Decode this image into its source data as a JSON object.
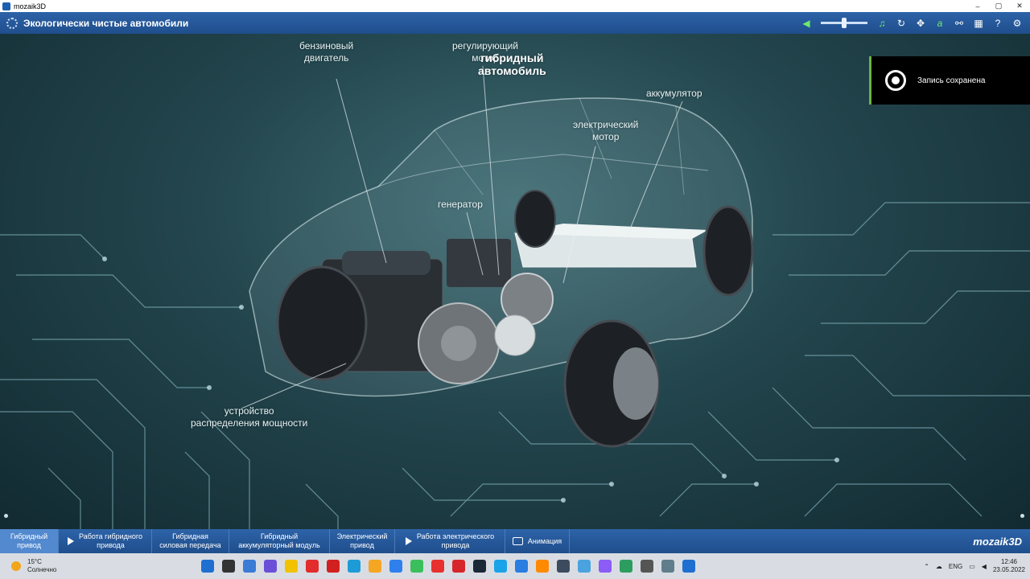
{
  "window": {
    "title": "mozaik3D",
    "controls": [
      "–",
      "▢",
      "✕"
    ]
  },
  "header": {
    "title": "Экологически чистые автомобили",
    "tools": [
      "music-icon",
      "reload-icon",
      "move-icon",
      "text-icon",
      "link-icon",
      "grid-icon",
      "help-icon",
      "settings-icon"
    ]
  },
  "scene": {
    "labels": {
      "engine": "бензиновый\nдвигатель",
      "regulating_motor": "регулирующий\nмотор",
      "hybrid_car": "гибридный\nавтомобиль",
      "battery": "аккумулятор",
      "electric_motor": "электрический\nмотор",
      "generator": "генератор",
      "power_split": "устройство\nраспределения мощности"
    },
    "toast": "Запись сохранена"
  },
  "nav": {
    "tabs": [
      {
        "label": "Гибридный\nпривод",
        "active": true,
        "icon": ""
      },
      {
        "label": "Работа гибридного\nпривода",
        "active": false,
        "icon": "play"
      },
      {
        "label": "Гибридная\nсиловая передача",
        "active": false,
        "icon": ""
      },
      {
        "label": "Гибридный\nаккумуляторный модуль",
        "active": false,
        "icon": ""
      },
      {
        "label": "Электрический\nпривод",
        "active": false,
        "icon": ""
      },
      {
        "label": "Работа электрического\nпривода",
        "active": false,
        "icon": "play"
      },
      {
        "label": "Анимация",
        "active": false,
        "icon": "anim"
      }
    ],
    "brand": "mozaik3D"
  },
  "taskbar": {
    "weather_temp": "15°C",
    "weather_text": "Солнечно",
    "lang": "ENG",
    "time": "12:46",
    "date": "23.05.2022",
    "app_colors": [
      "#1f6fd1",
      "#333333",
      "#3a7bd5",
      "#6b4fd8",
      "#f2c200",
      "#e32c2c",
      "#d21f1f",
      "#1d9bd7",
      "#f5a623",
      "#2f80ed",
      "#3bbf5c",
      "#e8312f",
      "#d7262b",
      "#1b2838",
      "#1aa3e8",
      "#2a7de1",
      "#ff8a00",
      "#3c4b5e",
      "#4aa3df",
      "#8b5cf6",
      "#2d9d5f",
      "#555555",
      "#607d8b",
      "#1f6fd1"
    ]
  }
}
